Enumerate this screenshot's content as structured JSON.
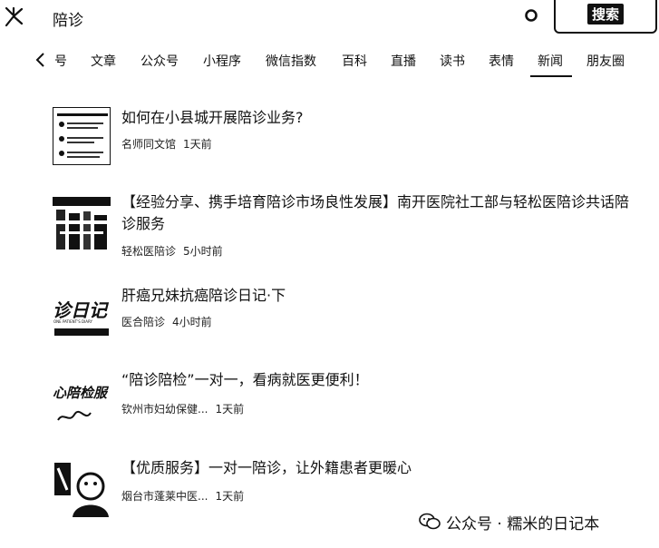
{
  "search": {
    "query": "陪诊",
    "button_label": "搜索"
  },
  "tabs": [
    "号",
    "文章",
    "公众号",
    "小程序",
    "微信指数",
    "百科",
    "直播",
    "读书",
    "表情",
    "新闻",
    "朋友圈"
  ],
  "active_tab": "新闻",
  "results": [
    {
      "title": "如何在小县城开展陪诊业务?",
      "source": "名师同文馆",
      "time": "1天前"
    },
    {
      "title": "【经验分享、携手培育陪诊市场良性发展】南开医院社工部与轻松医陪诊共话陪诊服务",
      "source": "轻松医陪诊",
      "time": "5小时前"
    },
    {
      "title": "肝癌兄妹抗癌陪诊日记·下",
      "source": "医合陪诊",
      "time": "4小时前",
      "thumb_text": "诊日记",
      "thumb_subtext": "ONE PATIENT'S DIARY"
    },
    {
      "title": "“陪诊陪检”一对一，看病就医更便利！",
      "source": "钦州市妇幼保健...",
      "time": "1天前",
      "thumb_text": "心陪检服"
    },
    {
      "title": "【优质服务】一对一陪诊，让外籍患者更暖心",
      "source": "烟台市蓬莱中医...",
      "time": "1天前"
    }
  ],
  "watermark": {
    "text": "公众号 · 糯米的日记本"
  }
}
